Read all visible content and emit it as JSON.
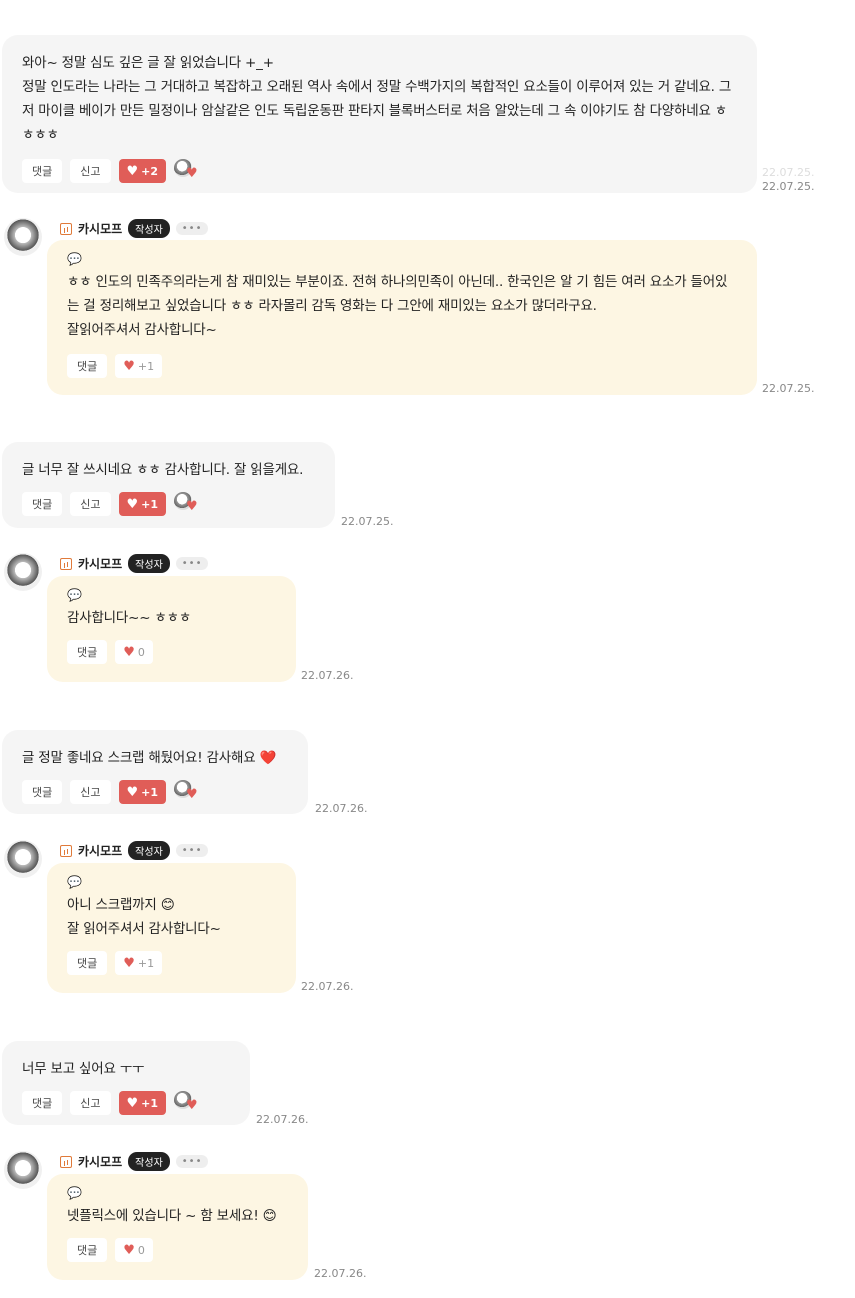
{
  "comments": [
    {
      "text": "와아~ 정말 심도 깊은 글 잘 읽었습니다 +_+\n정말 인도라는 나라는 그 거대하고 복잡하고 오래된 역사 속에서 정말 수백가지의 복합적인 요소들이 이루어져 있는 거 같네요. 그저 마이클 베이가 만든 밀정이나 암살같은 인도 독립운동판 판타지 블록버스터로 처음 알았는데 그 속 이야기도 참 다양하네요 ㅎㅎㅎㅎ",
      "reply_label": "댓글",
      "report_label": "신고",
      "like_count": "+2",
      "date": "22.07.25."
    },
    {
      "author": "카시모프",
      "badge": "작성자",
      "more": "•••",
      "text": "ㅎㅎ 인도의 민족주의라는게 참 재미있는 부분이죠. 전혀 하나의민족이 아닌데.. 한국인은 알 기 힘든 여러 요소가 들어있는 걸 정리해보고 싶었습니다 ㅎㅎ 라자몰리 감독 영화는 다 그안에 재미있는 요소가 많더라구요.\n잘읽어주셔서 감사합니다~",
      "reply_label": "댓글",
      "like_count": "+1",
      "date": "22.07.25."
    },
    {
      "text": "글 너무 잘 쓰시네요 ㅎㅎ 감사합니다. 잘 읽을게요.",
      "reply_label": "댓글",
      "report_label": "신고",
      "like_count": "+1",
      "date": "22.07.25."
    },
    {
      "author": "카시모프",
      "badge": "작성자",
      "more": "•••",
      "text": "감사합니다~~ ㅎㅎㅎ",
      "reply_label": "댓글",
      "like_count": "0",
      "date": "22.07.26."
    },
    {
      "text": "글 정말 좋네요 스크랩 해뒀어요! 감사해요 ❤️",
      "reply_label": "댓글",
      "report_label": "신고",
      "like_count": "+1",
      "date": "22.07.26."
    },
    {
      "author": "카시모프",
      "badge": "작성자",
      "more": "•••",
      "text": "아니 스크랩까지 😊\n잘 읽어주셔서 감사합니다~",
      "reply_label": "댓글",
      "like_count": "+1",
      "date": "22.07.26."
    },
    {
      "text": "너무 보고 싶어요 ㅜㅜ",
      "reply_label": "댓글",
      "report_label": "신고",
      "like_count": "+1",
      "date": "22.07.26."
    },
    {
      "author": "카시모프",
      "badge": "작성자",
      "more": "•••",
      "text": "넷플릭스에 있습니다 ~ 함 보세요! 😊",
      "reply_label": "댓글",
      "like_count": "0",
      "date": "22.07.26."
    }
  ],
  "ghost_date": "22.07.25."
}
